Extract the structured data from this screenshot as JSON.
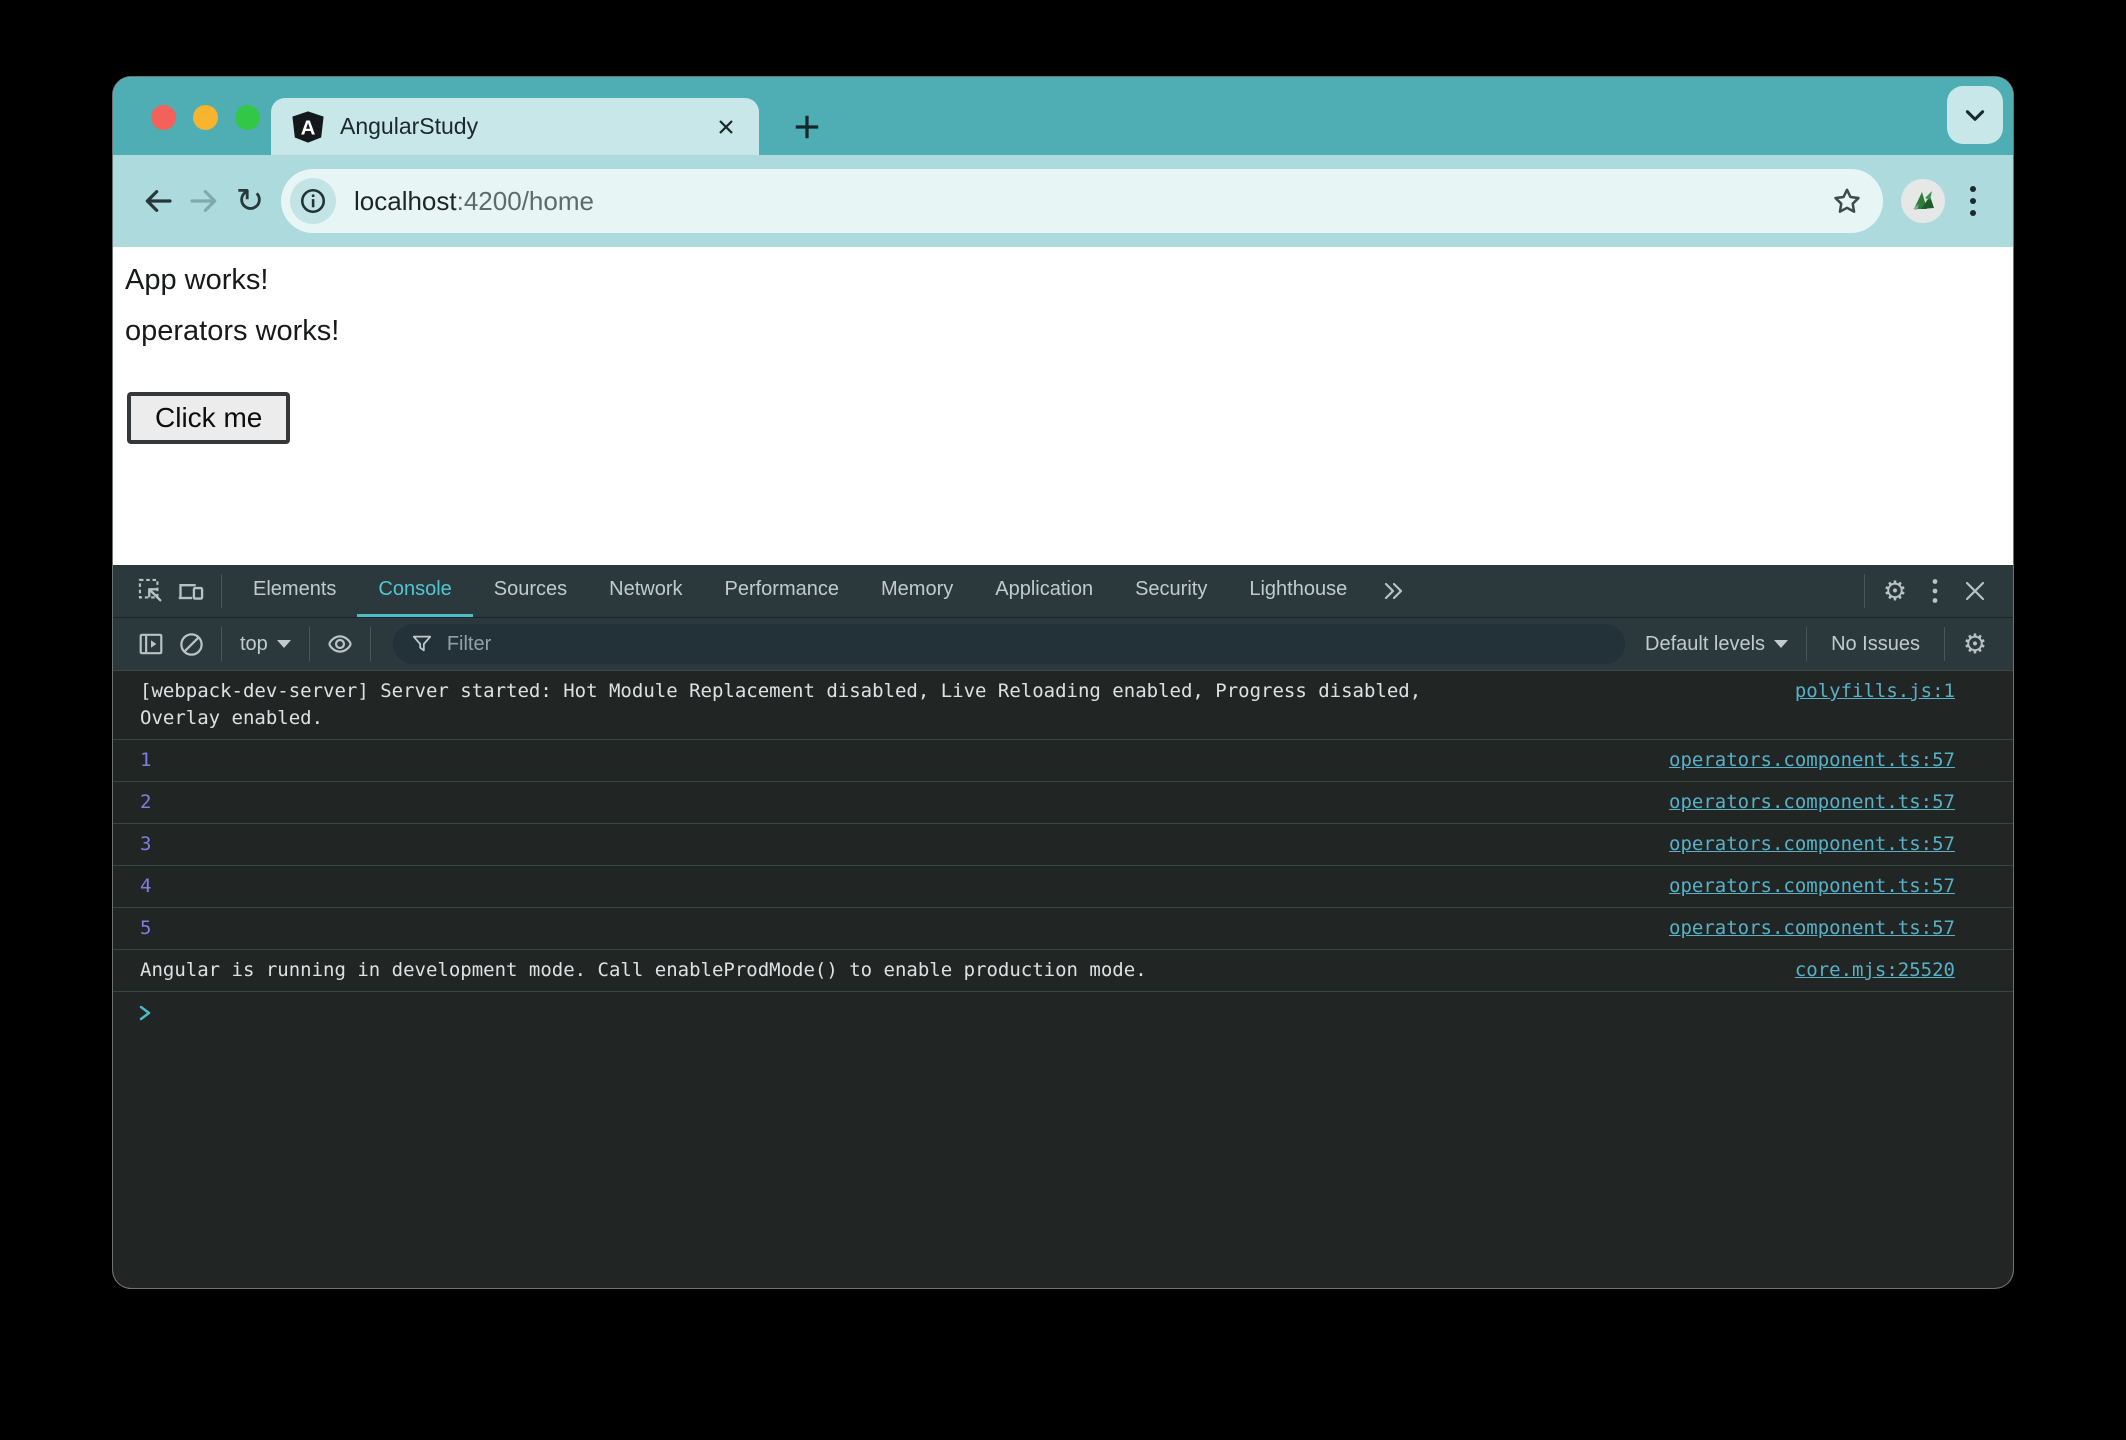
{
  "browser": {
    "tab_title": "AngularStudy",
    "url": {
      "host": "localhost",
      "rest": ":4200/home"
    }
  },
  "page": {
    "line1": "App works!",
    "line2": "operators works!",
    "button_label": "Click me"
  },
  "devtools": {
    "tabs": [
      "Elements",
      "Console",
      "Sources",
      "Network",
      "Performance",
      "Memory",
      "Application",
      "Security",
      "Lighthouse"
    ],
    "active_tab": "Console",
    "toolbar": {
      "context_selector": "top",
      "filter_placeholder": "Filter",
      "levels_label": "Default levels",
      "issues_label": "No Issues"
    },
    "console_messages": [
      {
        "kind": "log",
        "text": "[webpack-dev-server] Server started: Hot Module Replacement disabled, Live Reloading enabled, Progress disabled, Overlay enabled.",
        "source": "polyfills.js:1"
      },
      {
        "kind": "value",
        "text": "1",
        "source": "operators.component.ts:57"
      },
      {
        "kind": "value",
        "text": "2",
        "source": "operators.component.ts:57"
      },
      {
        "kind": "value",
        "text": "3",
        "source": "operators.component.ts:57"
      },
      {
        "kind": "value",
        "text": "4",
        "source": "operators.component.ts:57"
      },
      {
        "kind": "value",
        "text": "5",
        "source": "operators.component.ts:57"
      },
      {
        "kind": "log",
        "text": "Angular is running in development mode. Call enableProdMode() to enable production mode.",
        "source": "core.mjs:25520"
      }
    ]
  },
  "colors": {
    "titlebar_teal": "#4FAEB4",
    "toolbar_teal": "#ADDBDD",
    "active_tab_teal": "#C7E7E8",
    "devtools_bg": "#2B383C",
    "console_bg": "#212625",
    "devtools_accent": "#4EBBC9",
    "console_link": "#58B1C7",
    "console_number": "#807EE4",
    "traffic_red": "#F4605A",
    "traffic_yellow": "#F8B42E",
    "traffic_green": "#33C748"
  }
}
